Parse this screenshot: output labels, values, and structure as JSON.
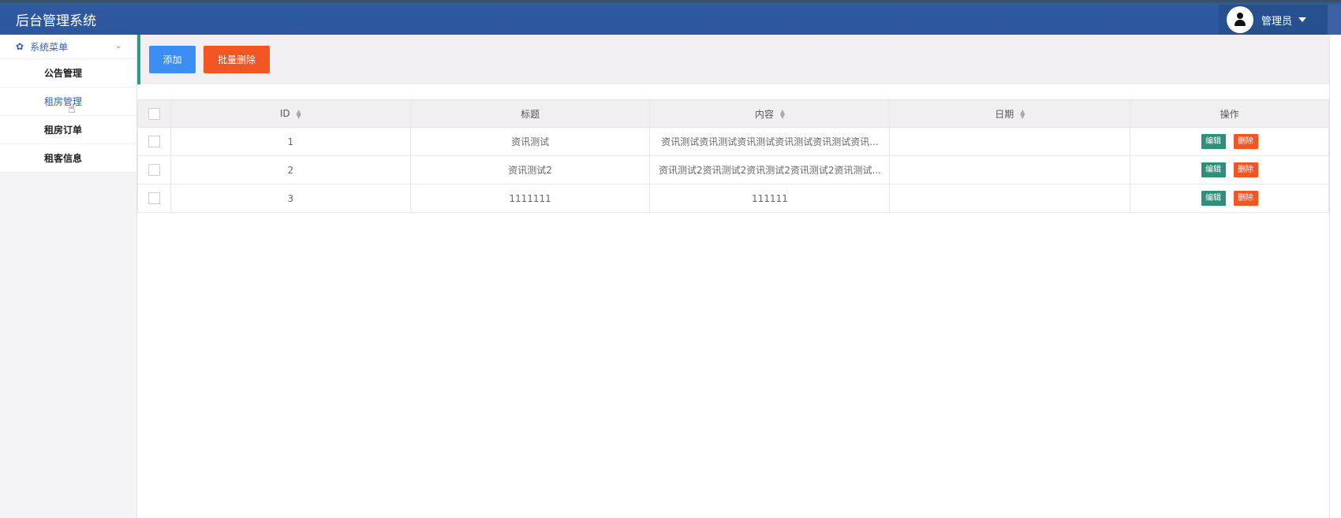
{
  "header": {
    "title": "后台管理系统",
    "user": "管理员"
  },
  "sidebar": {
    "menu_title": "系统菜单",
    "items": [
      {
        "label": "公告管理"
      },
      {
        "label": "租房管理"
      },
      {
        "label": "租房订单"
      },
      {
        "label": "租客信息"
      }
    ]
  },
  "toolbar": {
    "add_label": "添加",
    "batch_delete_label": "批量删除"
  },
  "table": {
    "columns": [
      "ID",
      "标题",
      "内容",
      "日期",
      "操作"
    ],
    "edit_label": "编辑",
    "delete_label": "删除",
    "rows": [
      {
        "id": "1",
        "title": "资讯测试",
        "content": "资讯测试资讯测试资讯测试资讯测试资讯测试资讯...",
        "date": ""
      },
      {
        "id": "2",
        "title": "资讯测试2",
        "content": "资讯测试2资讯测试2资讯测试2资讯测试2资讯测试...",
        "date": ""
      },
      {
        "id": "3",
        "title": "1111111",
        "content": "111111",
        "date": ""
      }
    ]
  },
  "colors": {
    "header": "#2c57a0",
    "add": "#3d8ef2",
    "delete": "#f25624",
    "edit": "#2f8f79",
    "accent": "#2f9a83"
  }
}
